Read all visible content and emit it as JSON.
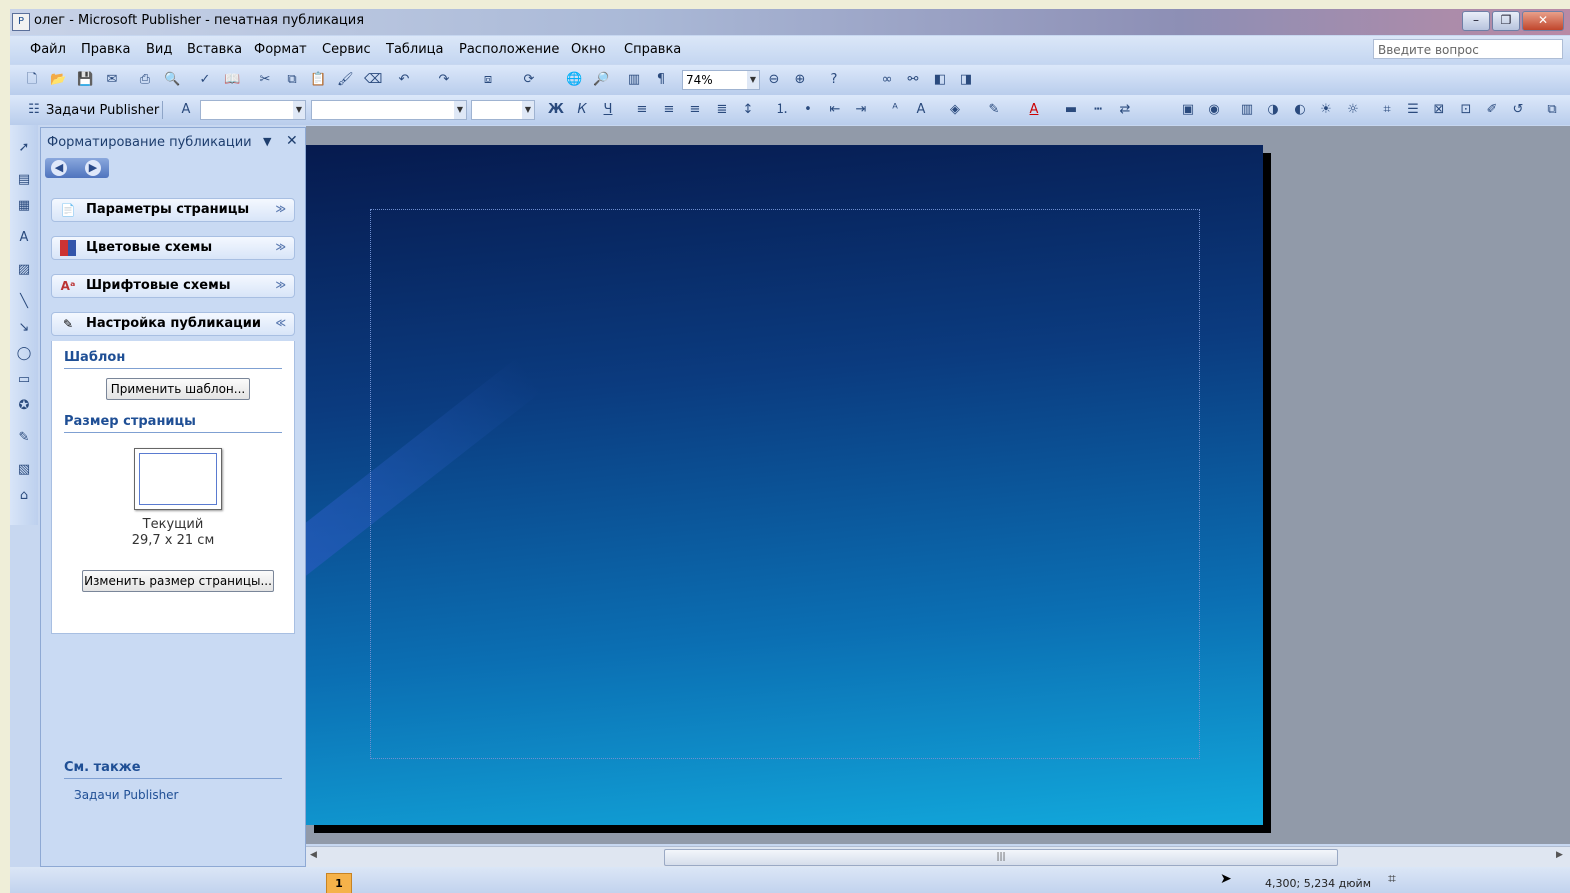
{
  "window": {
    "title": "олег - Microsoft Publisher - печатная публикация"
  },
  "menu": [
    "Файл",
    "Правка",
    "Вид",
    "Вставка",
    "Формат",
    "Сервис",
    "Таблица",
    "Расположение",
    "Окно",
    "Справка"
  ],
  "ask_placeholder": "Введите вопрос",
  "toolbar": {
    "zoom": "74%",
    "tasks_label": "Задачи Publisher"
  },
  "taskpane": {
    "title": "Форматирование публикации",
    "sections": [
      "Параметры страницы",
      "Цветовые схемы",
      "Шрифтовые схемы",
      "Настройка публикации"
    ],
    "template_heading": "Шаблон",
    "apply_template_button": "Применить шаблон...",
    "page_size_heading": "Размер страницы",
    "current_label": "Текущий",
    "current_size": "29,7 x 21 см",
    "change_size_button": "Изменить размер страницы...",
    "see_also": "См. также",
    "see_also_link": "Задачи Publisher"
  },
  "status": {
    "page_number": "1",
    "coordinates": "4,300; 5,234 дюйм"
  },
  "colors": {
    "page_top": "#061a4e",
    "page_bottom": "#12a9dc",
    "workspace": "#919aa9"
  }
}
